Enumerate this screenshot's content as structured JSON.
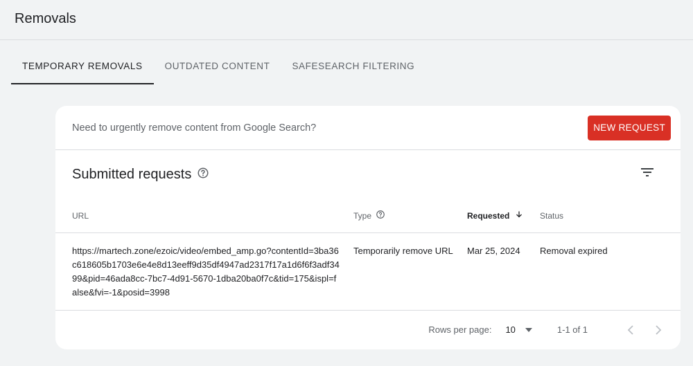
{
  "header": {
    "title": "Removals"
  },
  "tabs": [
    {
      "label": "TEMPORARY REMOVALS",
      "active": true
    },
    {
      "label": "OUTDATED CONTENT",
      "active": false
    },
    {
      "label": "SAFESEARCH FILTERING",
      "active": false
    }
  ],
  "banner": {
    "text": "Need to urgently remove content from Google Search?",
    "button_label": "NEW REQUEST",
    "button_color": "#d93025"
  },
  "section": {
    "title": "Submitted requests",
    "help_icon": "help-circle-icon",
    "filter_icon": "filter-list-icon"
  },
  "table": {
    "columns": {
      "url": "URL",
      "type": "Type",
      "requested": "Requested",
      "status": "Status"
    },
    "rows": [
      {
        "url": "https://martech.zone/ezoic/video/embed_amp.go?contentId=3ba36c618605b1703e6e4e8d13eeff9d35df4947ad2317f17a1d6f6f3adf3499&pid=46ada8cc-7bc7-4d91-5670-1dba20ba0f7c&tid=175&ispl=false&fvi=-1&posid=3998",
        "type": "Temporarily remove URL",
        "requested": "Mar 25, 2024",
        "status": "Removal expired"
      }
    ]
  },
  "pagination": {
    "rows_per_page_label": "Rows per page:",
    "rows_per_page_value": "10",
    "range": "1-1 of 1"
  }
}
